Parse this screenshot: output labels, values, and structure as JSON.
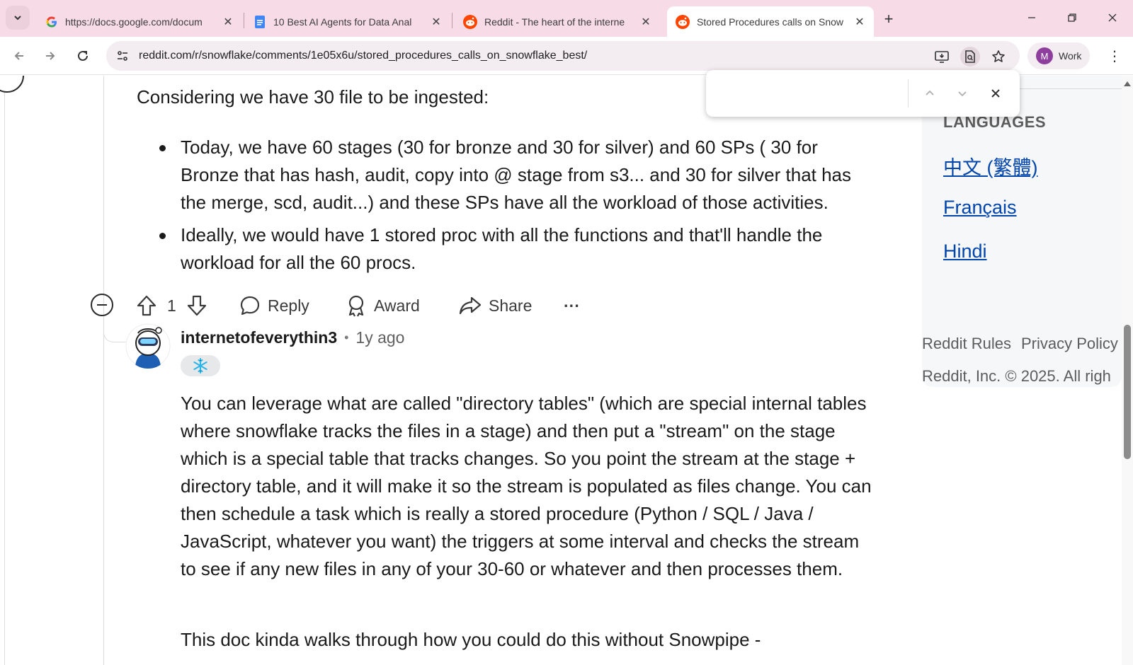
{
  "browser": {
    "tabs": [
      {
        "title": "https://docs.google.com/docum",
        "icon": "google-icon"
      },
      {
        "title": "10 Best AI Agents for Data Anal",
        "icon": "docs-icon"
      },
      {
        "title": "Reddit - The heart of the interne",
        "icon": "reddit-icon"
      },
      {
        "title": "Stored Procedures calls on Snow",
        "icon": "reddit-icon",
        "active": true
      }
    ],
    "url": "reddit.com/r/snowflake/comments/1e05x6u/stored_procedures_calls_on_snowflake_best/",
    "profile_label": "Work",
    "profile_initial": "M",
    "colors": {
      "tabstrip": "#f7dbe6",
      "profile_avatar": "#8e3f9e",
      "link": "#0045ac"
    }
  },
  "find_bar": {
    "query": "",
    "placeholder": ""
  },
  "comment1": {
    "intro": "Considering we have 30 file to be ingested:",
    "bullets": [
      "Today, we have 60 stages (30 for bronze and 30 for silver) and 60 SPs ( 30 for Bronze that has hash, audit, copy into @ stage from s3... and 30 for silver that has the merge, scd, audit...) and these SPs have all the workload of those activities.",
      "Ideally, we would have 1 stored proc with all the functions and that'll handle the workload for all the 60 procs."
    ],
    "actions": {
      "votes": "1",
      "reply": "Reply",
      "award": "Award",
      "share": "Share",
      "more": "···"
    }
  },
  "comment2": {
    "username": "internetofeverythin3",
    "separator": "•",
    "time": "1y ago",
    "flair_icon": "snowflake-icon",
    "paragraph1": "You can leverage what are called \"directory tables\" (which are special internal tables where snowflake tracks the files in a stage) and then put a \"stream\" on the stage which is a special table that tracks changes. So you point the stream at the stage + directory table, and it will make it so the stream is populated as files change. You can then schedule a task which is really a stored procedure (Python / SQL / Java / JavaScript, whatever you want) the triggers at some interval and checks the stream to see if any new files in any of your 30-60 or whatever and then processes them.",
    "paragraph2": "This doc kinda walks through how you could do this without Snowpipe -"
  },
  "sidebar": {
    "languages_heading": "LANGUAGES",
    "languages": [
      "中文 (繁體)",
      "Français",
      "Hindi"
    ],
    "footer_links": [
      "Reddit Rules",
      "Privacy Policy"
    ],
    "copyright": "Reddit, Inc. © 2025. All righ"
  }
}
